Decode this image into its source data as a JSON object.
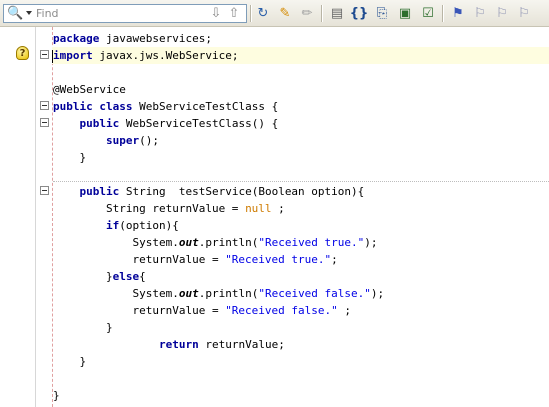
{
  "toolbar": {
    "find_placeholder": "Find",
    "buttons": [
      {
        "name": "find-next-button",
        "icon": "arrow-down-icon"
      },
      {
        "name": "find-previous-button",
        "icon": "arrow-up-icon"
      },
      {
        "name": "toggle-highlight-button",
        "icon": "highlight-icon"
      },
      {
        "name": "last-edit-button",
        "icon": "brush-icon"
      },
      {
        "name": "shift-left-button",
        "icon": "pencil-icon"
      },
      {
        "name": "shift-right-button",
        "icon": "indent-icon"
      },
      {
        "name": "start-macro-button",
        "icon": "braces-icon"
      },
      {
        "name": "stop-macro-button",
        "icon": "macro-icon"
      },
      {
        "name": "comment-button",
        "icon": "window-icon"
      },
      {
        "name": "uncomment-button",
        "icon": "check-window-icon"
      },
      {
        "name": "toggle-bookmark-button",
        "icon": "bookmark-icon"
      },
      {
        "name": "previous-bookmark-button",
        "icon": "prev-bookmark-icon"
      },
      {
        "name": "next-bookmark-button",
        "icon": "next-bookmark-icon"
      },
      {
        "name": "last-bookmark-button",
        "icon": "bookmark-end-icon"
      }
    ]
  },
  "code": [
    [
      [
        "kw",
        "package"
      ],
      [
        "t",
        " javawebservices;"
      ]
    ],
    [
      [
        "kw",
        "import"
      ],
      [
        "t",
        " javax.jws.WebService;"
      ]
    ],
    [],
    [
      [
        "t",
        "@WebService"
      ]
    ],
    [
      [
        "kw",
        "public"
      ],
      [
        "t",
        " "
      ],
      [
        "kw",
        "class"
      ],
      [
        "t",
        " WebServiceTestClass {"
      ]
    ],
    [
      [
        "t",
        "    "
      ],
      [
        "kw",
        "public"
      ],
      [
        "t",
        " WebServiceTestClass() {"
      ]
    ],
    [
      [
        "t",
        "        "
      ],
      [
        "kw",
        "super"
      ],
      [
        "t",
        "();"
      ]
    ],
    [
      [
        "t",
        "    }"
      ]
    ],
    [],
    [
      [
        "t",
        "    "
      ],
      [
        "kw",
        "public"
      ],
      [
        "t",
        " String  testService(Boolean option){"
      ]
    ],
    [
      [
        "t",
        "        String returnValue = "
      ],
      [
        "lit",
        "null"
      ],
      [
        "t",
        " ;"
      ]
    ],
    [
      [
        "t",
        "        "
      ],
      [
        "kw",
        "if"
      ],
      [
        "t",
        "(option){"
      ]
    ],
    [
      [
        "t",
        "            System."
      ],
      [
        "field",
        "out"
      ],
      [
        "t",
        ".println("
      ],
      [
        "str2",
        "\"Received true.\""
      ],
      [
        "t",
        ");"
      ]
    ],
    [
      [
        "t",
        "            returnValue = "
      ],
      [
        "str2",
        "\"Received true.\""
      ],
      [
        "t",
        ";"
      ]
    ],
    [
      [
        "t",
        "        }"
      ],
      [
        "kw",
        "else"
      ],
      [
        "t",
        "{"
      ]
    ],
    [
      [
        "t",
        "            System."
      ],
      [
        "field",
        "out"
      ],
      [
        "t",
        ".println("
      ],
      [
        "str2",
        "\"Received false.\""
      ],
      [
        "t",
        ");"
      ]
    ],
    [
      [
        "t",
        "            returnValue = "
      ],
      [
        "str2",
        "\"Received false.\""
      ],
      [
        "t",
        " ;"
      ]
    ],
    [
      [
        "t",
        "        }"
      ]
    ],
    [
      [
        "t",
        "                "
      ],
      [
        "kw",
        "return"
      ],
      [
        "t",
        " returnValue;"
      ]
    ],
    [
      [
        "t",
        "    }"
      ]
    ],
    [],
    [
      [
        "t",
        "}"
      ]
    ]
  ],
  "highlighted_line": 1,
  "hint_line": 1,
  "fold_lines": [
    1,
    4,
    5,
    9
  ],
  "colors": {
    "keyword": "#000099",
    "string": "#0000e6",
    "literal": "#ce7b00",
    "current_line": "#fefde0"
  }
}
